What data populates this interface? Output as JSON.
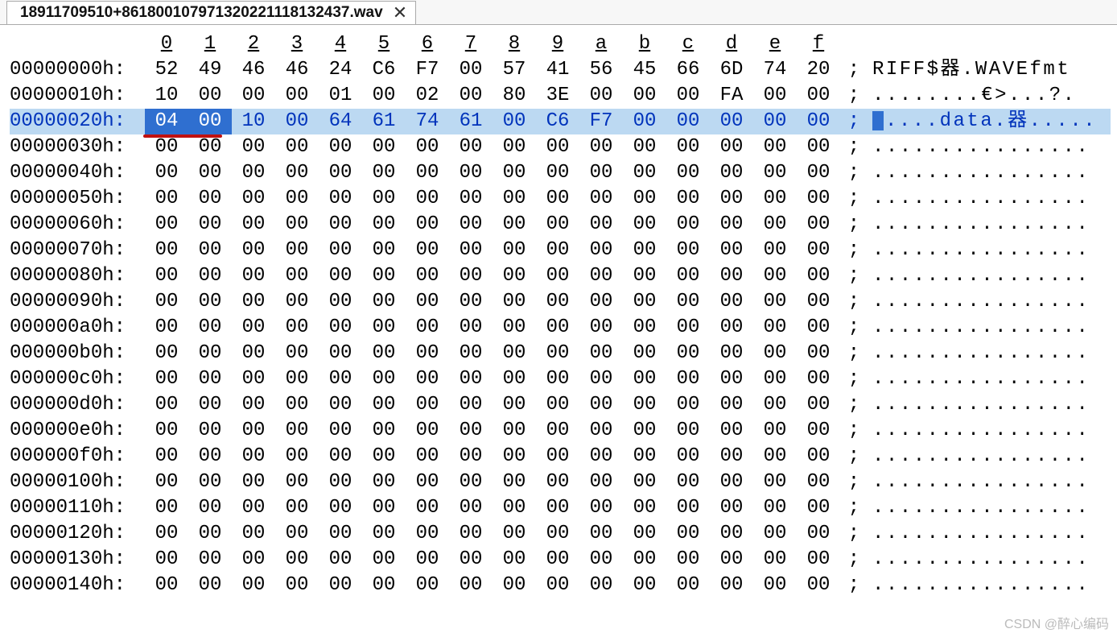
{
  "tab": {
    "filename": "18911709510+8618001079713202211181324​37.wav",
    "close_label": "✕"
  },
  "columns": [
    "0",
    "1",
    "2",
    "3",
    "4",
    "5",
    "6",
    "7",
    "8",
    "9",
    "a",
    "b",
    "c",
    "d",
    "e",
    "f"
  ],
  "rows": [
    {
      "offset": "00000000h:",
      "hex": [
        "52",
        "49",
        "46",
        "46",
        "24",
        "C6",
        "F7",
        "00",
        "57",
        "41",
        "56",
        "45",
        "66",
        "6D",
        "74",
        "20"
      ],
      "ascii": "RIFF$器.WAVEfmt "
    },
    {
      "offset": "00000010h:",
      "hex": [
        "10",
        "00",
        "00",
        "00",
        "01",
        "00",
        "02",
        "00",
        "80",
        "3E",
        "00",
        "00",
        "00",
        "FA",
        "00",
        "00"
      ],
      "ascii": "........€>...?. "
    },
    {
      "offset": "00000020h:",
      "hex": [
        "04",
        "00",
        "10",
        "00",
        "64",
        "61",
        "74",
        "61",
        "00",
        "C6",
        "F7",
        "00",
        "00",
        "00",
        "00",
        "00"
      ],
      "ascii": "....data.器.....",
      "selected": true,
      "strong": [
        0,
        1
      ]
    },
    {
      "offset": "00000030h:",
      "hex": [
        "00",
        "00",
        "00",
        "00",
        "00",
        "00",
        "00",
        "00",
        "00",
        "00",
        "00",
        "00",
        "00",
        "00",
        "00",
        "00"
      ],
      "ascii": "................"
    },
    {
      "offset": "00000040h:",
      "hex": [
        "00",
        "00",
        "00",
        "00",
        "00",
        "00",
        "00",
        "00",
        "00",
        "00",
        "00",
        "00",
        "00",
        "00",
        "00",
        "00"
      ],
      "ascii": "................"
    },
    {
      "offset": "00000050h:",
      "hex": [
        "00",
        "00",
        "00",
        "00",
        "00",
        "00",
        "00",
        "00",
        "00",
        "00",
        "00",
        "00",
        "00",
        "00",
        "00",
        "00"
      ],
      "ascii": "................"
    },
    {
      "offset": "00000060h:",
      "hex": [
        "00",
        "00",
        "00",
        "00",
        "00",
        "00",
        "00",
        "00",
        "00",
        "00",
        "00",
        "00",
        "00",
        "00",
        "00",
        "00"
      ],
      "ascii": "................"
    },
    {
      "offset": "00000070h:",
      "hex": [
        "00",
        "00",
        "00",
        "00",
        "00",
        "00",
        "00",
        "00",
        "00",
        "00",
        "00",
        "00",
        "00",
        "00",
        "00",
        "00"
      ],
      "ascii": "................"
    },
    {
      "offset": "00000080h:",
      "hex": [
        "00",
        "00",
        "00",
        "00",
        "00",
        "00",
        "00",
        "00",
        "00",
        "00",
        "00",
        "00",
        "00",
        "00",
        "00",
        "00"
      ],
      "ascii": "................"
    },
    {
      "offset": "00000090h:",
      "hex": [
        "00",
        "00",
        "00",
        "00",
        "00",
        "00",
        "00",
        "00",
        "00",
        "00",
        "00",
        "00",
        "00",
        "00",
        "00",
        "00"
      ],
      "ascii": "................"
    },
    {
      "offset": "000000a0h:",
      "hex": [
        "00",
        "00",
        "00",
        "00",
        "00",
        "00",
        "00",
        "00",
        "00",
        "00",
        "00",
        "00",
        "00",
        "00",
        "00",
        "00"
      ],
      "ascii": "................"
    },
    {
      "offset": "000000b0h:",
      "hex": [
        "00",
        "00",
        "00",
        "00",
        "00",
        "00",
        "00",
        "00",
        "00",
        "00",
        "00",
        "00",
        "00",
        "00",
        "00",
        "00"
      ],
      "ascii": "................"
    },
    {
      "offset": "000000c0h:",
      "hex": [
        "00",
        "00",
        "00",
        "00",
        "00",
        "00",
        "00",
        "00",
        "00",
        "00",
        "00",
        "00",
        "00",
        "00",
        "00",
        "00"
      ],
      "ascii": "................"
    },
    {
      "offset": "000000d0h:",
      "hex": [
        "00",
        "00",
        "00",
        "00",
        "00",
        "00",
        "00",
        "00",
        "00",
        "00",
        "00",
        "00",
        "00",
        "00",
        "00",
        "00"
      ],
      "ascii": "................"
    },
    {
      "offset": "000000e0h:",
      "hex": [
        "00",
        "00",
        "00",
        "00",
        "00",
        "00",
        "00",
        "00",
        "00",
        "00",
        "00",
        "00",
        "00",
        "00",
        "00",
        "00"
      ],
      "ascii": "................"
    },
    {
      "offset": "000000f0h:",
      "hex": [
        "00",
        "00",
        "00",
        "00",
        "00",
        "00",
        "00",
        "00",
        "00",
        "00",
        "00",
        "00",
        "00",
        "00",
        "00",
        "00"
      ],
      "ascii": "................"
    },
    {
      "offset": "00000100h:",
      "hex": [
        "00",
        "00",
        "00",
        "00",
        "00",
        "00",
        "00",
        "00",
        "00",
        "00",
        "00",
        "00",
        "00",
        "00",
        "00",
        "00"
      ],
      "ascii": "................"
    },
    {
      "offset": "00000110h:",
      "hex": [
        "00",
        "00",
        "00",
        "00",
        "00",
        "00",
        "00",
        "00",
        "00",
        "00",
        "00",
        "00",
        "00",
        "00",
        "00",
        "00"
      ],
      "ascii": "................"
    },
    {
      "offset": "00000120h:",
      "hex": [
        "00",
        "00",
        "00",
        "00",
        "00",
        "00",
        "00",
        "00",
        "00",
        "00",
        "00",
        "00",
        "00",
        "00",
        "00",
        "00"
      ],
      "ascii": "................"
    },
    {
      "offset": "00000130h:",
      "hex": [
        "00",
        "00",
        "00",
        "00",
        "00",
        "00",
        "00",
        "00",
        "00",
        "00",
        "00",
        "00",
        "00",
        "00",
        "00",
        "00"
      ],
      "ascii": "................"
    },
    {
      "offset": "00000140h:",
      "hex": [
        "00",
        "00",
        "00",
        "00",
        "00",
        "00",
        "00",
        "00",
        "00",
        "00",
        "00",
        "00",
        "00",
        "00",
        "00",
        "00"
      ],
      "ascii": "................"
    }
  ],
  "separator": ";",
  "watermark": "CSDN @醉心编码"
}
